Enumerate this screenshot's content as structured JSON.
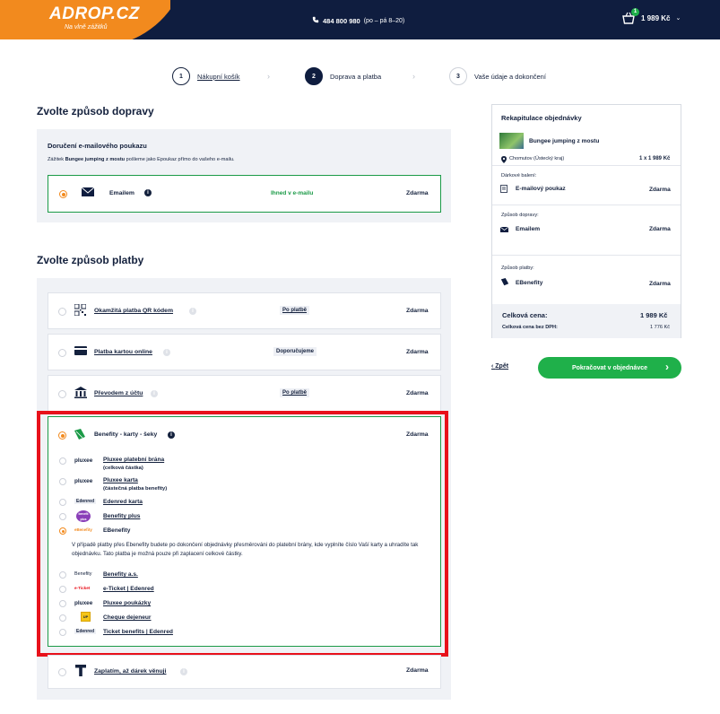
{
  "header": {
    "logo": "ADROP.CZ",
    "logo_tagline": "Na vlně zážitků",
    "phone": "484 800 980",
    "phone_hours": "(po – pá 8–20)",
    "cart_count": "1",
    "cart_total": "1 989 Kč"
  },
  "steps": [
    {
      "num": "1",
      "label": "Nákupní košík"
    },
    {
      "num": "2",
      "label": "Doprava a platba"
    },
    {
      "num": "3",
      "label": "Vaše údaje a dokončení"
    }
  ],
  "delivery": {
    "heading": "Zvolte způsob dopravy",
    "box_title": "Doručení e-mailového poukazu",
    "box_sub_prefix": "Zážitek ",
    "box_sub_bold": "Bungee jumping z mostu",
    "box_sub_suffix": " pošleme jako Epoukaz přímo do vašeho e-mailu.",
    "option_label": "Emailem",
    "option_note": "Ihned v e-mailu",
    "option_price": "Zdarma"
  },
  "payment": {
    "heading": "Zvolte způsob platby",
    "options": [
      {
        "label": "Okamžitá platba QR kódem",
        "tag": "Po platbě",
        "price": "Zdarma"
      },
      {
        "label": "Platba kartou online",
        "tag": "Doporučujeme",
        "price": "Zdarma"
      },
      {
        "label": "Převodem z účtu",
        "tag": "Po platbě",
        "price": "Zdarma"
      }
    ],
    "benefit": {
      "label": "Benefity - karty - šeky",
      "price": "Zdarma",
      "subs": [
        {
          "brand": "pluxee",
          "label": "Pluxee platební brána",
          "note": "(celková částka)"
        },
        {
          "brand": "pluxee",
          "label": "Pluxee karta",
          "note": "(částečná platba benefity)"
        },
        {
          "brand": "Edenred",
          "label": "Edenred karta",
          "note": ""
        },
        {
          "brand": "benefit plus",
          "label": "Benefity plus",
          "note": ""
        },
        {
          "brand": "eBenefity",
          "label": "EBenefity",
          "note": ""
        }
      ],
      "description": "V případě platby přes Ebenefity budete po dokončení objednávky přesměrováni do platební brány, kde vyplníte číslo Vaší karty a uhradíte tak objednávku. Tato platba je možná pouze při zaplacení celkové částky.",
      "subs2": [
        {
          "brand": "Benefity",
          "label": "Benefity a.s."
        },
        {
          "brand": "e-Ticket",
          "label": "e-Ticket | Edenred"
        },
        {
          "brand": "pluxee",
          "label": "Pluxee poukázky"
        },
        {
          "brand": "UP",
          "label": "Cheque dejeneur"
        },
        {
          "brand": "Edenred",
          "label": "Ticket benefits | Edenred"
        }
      ]
    },
    "last_option": {
      "label": "Zaplatím, až dárek věnuji",
      "price": "Zdarma"
    }
  },
  "summary": {
    "title": "Rekapitulace objednávky",
    "product": "Bungee jumping z mostu",
    "location": "Chomutov (Ústecký kraj)",
    "qty_price": "1 x 1 989 Kč",
    "gift_label": "Dárkové balení:",
    "gift_value": "E-mailový poukaz",
    "gift_price": "Zdarma",
    "delivery_label": "Způsob dopravy:",
    "delivery_value": "Emailem",
    "delivery_price": "Zdarma",
    "payment_label": "Způsob platby:",
    "payment_value": "EBenefity",
    "payment_price": "Zdarma",
    "total_label": "Celková cena:",
    "total_value": "1 989 Kč",
    "net_label": "Celková cena bez DPH:",
    "net_value": "1 776 Kč"
  },
  "actions": {
    "back": "Zpět",
    "continue": "Pokračovat v objednávce"
  },
  "colors": {
    "navy": "#0f1d3f",
    "orange": "#f28a1e",
    "green": "#1fb04a",
    "highlight": "#e8111b"
  }
}
